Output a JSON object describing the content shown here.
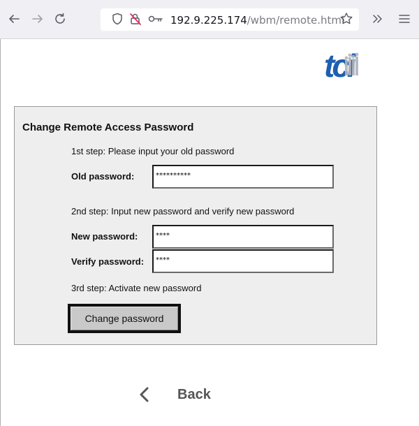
{
  "browser": {
    "url_host": "192.9.225.174",
    "url_path": "/wbm/remote.html",
    "icons": {
      "back": "arrow-left-icon",
      "forward": "arrow-right-icon",
      "reload": "reload-icon",
      "shield": "shield-icon",
      "insecure": "insecure-lock-icon",
      "key": "key-icon",
      "bookmark": "star-icon",
      "overflow": "chevrons-right-icon",
      "menu": "hamburger-menu-icon"
    }
  },
  "logo": {
    "text": "tci",
    "color": "#1f5fb0"
  },
  "form": {
    "title": "Change Remote Access Password",
    "step1": "1st step: Please input your old password",
    "old_password_label": "Old password:",
    "old_password_value": "**********",
    "step2": "2nd step: Input new password and verify new password",
    "new_password_label": "New password:",
    "new_password_value": "****",
    "verify_password_label": "Verify password:",
    "verify_password_value": "****",
    "step3": "3rd step: Activate new password",
    "button_label": "Change password"
  },
  "nav": {
    "back_label": "Back"
  }
}
